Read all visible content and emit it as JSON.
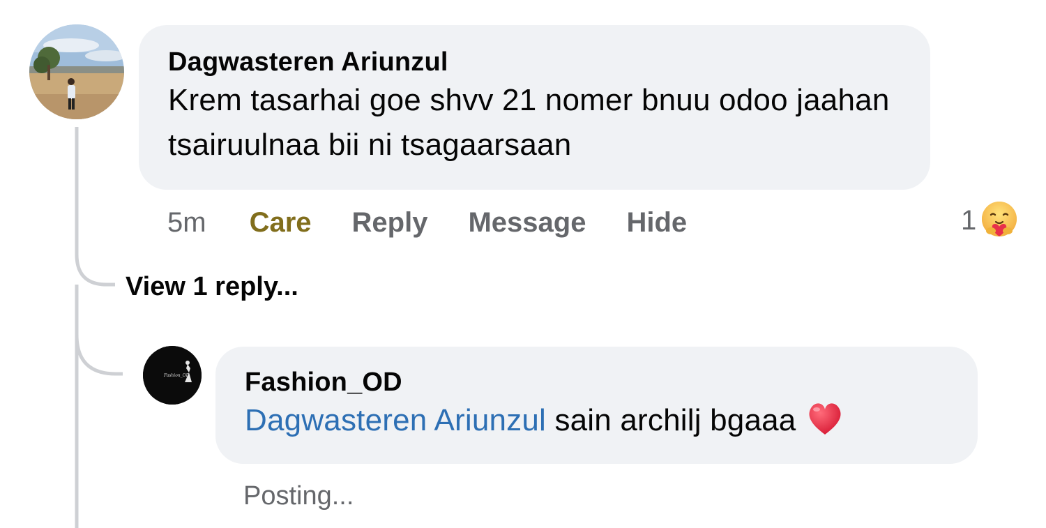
{
  "comment": {
    "author": "Dagwasteren Ariunzul",
    "text": "Krem tasarhai goe shvv  21 nomer bnuu odoo jaahan tsairuulnaa bii ni tsagaarsaan",
    "time": "5m",
    "reaction_label": "Care",
    "reply_label": "Reply",
    "message_label": "Message",
    "hide_label": "Hide",
    "reaction_count": "1",
    "reaction_icon": "care-emoji-icon",
    "reaction_color": "#816e1c"
  },
  "view_replies": "View 1 reply...",
  "reply": {
    "author": "Fashion_OD",
    "mention": "Dagwasteren Ariunzul",
    "text": " sain archilj bgaaa",
    "emoji": "heart-emoji-icon",
    "status": "Posting...",
    "avatar_text": "Fashion_OD"
  },
  "colors": {
    "bubble": "#f0f2f5",
    "mention": "#2d6fb4",
    "secondary_text": "#65676b",
    "care": "#816e1c"
  }
}
